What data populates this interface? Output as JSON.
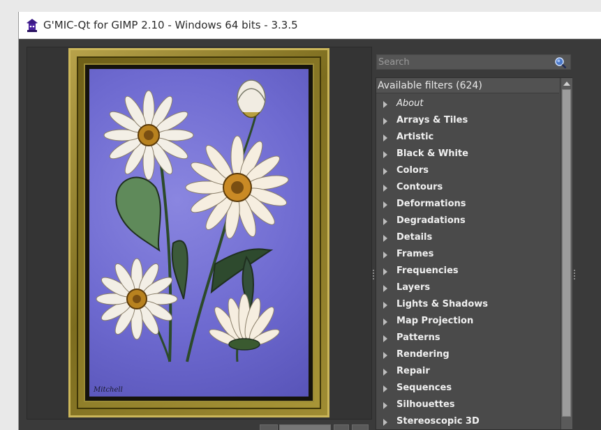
{
  "window": {
    "title": "G'MIC-Qt for GIMP 2.10 - Windows 64 bits - 3.3.5",
    "icon": "gmic-wizard-icon"
  },
  "preview": {
    "signature": "Mitchell",
    "frame_color": "#9f8c33",
    "background_color": "#6e6ad0"
  },
  "search": {
    "placeholder": "Search",
    "value": "",
    "icon": "search-icon"
  },
  "filters": {
    "header": "Available filters (624)",
    "items": [
      {
        "label": "About",
        "italic": true
      },
      {
        "label": "Arrays & Tiles"
      },
      {
        "label": "Artistic"
      },
      {
        "label": "Black & White"
      },
      {
        "label": "Colors"
      },
      {
        "label": "Contours"
      },
      {
        "label": "Deformations"
      },
      {
        "label": "Degradations"
      },
      {
        "label": "Details"
      },
      {
        "label": "Frames"
      },
      {
        "label": "Frequencies"
      },
      {
        "label": "Layers"
      },
      {
        "label": "Lights & Shadows"
      },
      {
        "label": "Map Projection"
      },
      {
        "label": "Patterns"
      },
      {
        "label": "Rendering"
      },
      {
        "label": "Repair"
      },
      {
        "label": "Sequences"
      },
      {
        "label": "Silhouettes"
      },
      {
        "label": "Stereoscopic 3D"
      }
    ]
  },
  "colors": {
    "panel_bg": "#3a3a3a",
    "tree_bg": "#4a4a4a",
    "text": "#f0f0f0"
  }
}
